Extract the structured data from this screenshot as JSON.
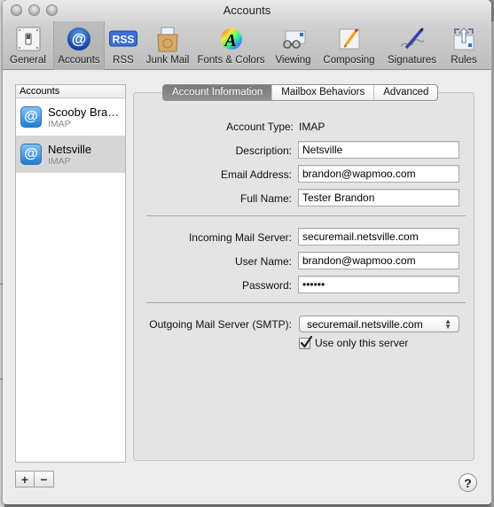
{
  "window": {
    "title": "Accounts"
  },
  "toolbar": {
    "items": [
      {
        "label": "General",
        "icon": "light-switch-icon",
        "selected": false
      },
      {
        "label": "Accounts",
        "icon": "at-sign-icon",
        "selected": true
      },
      {
        "label": "RSS",
        "icon": "rss-icon",
        "selected": false
      },
      {
        "label": "Junk Mail",
        "icon": "recycle-bag-icon",
        "selected": false
      },
      {
        "label": "Fonts & Colors",
        "icon": "color-wheel-font-icon",
        "selected": false
      },
      {
        "label": "Viewing",
        "icon": "glasses-envelope-icon",
        "selected": false
      },
      {
        "label": "Composing",
        "icon": "pencil-paper-icon",
        "selected": false
      },
      {
        "label": "Signatures",
        "icon": "pen-signature-icon",
        "selected": false
      },
      {
        "label": "Rules",
        "icon": "arrows-envelope-icon",
        "selected": false
      }
    ]
  },
  "accounts_list": {
    "header": "Accounts",
    "items": [
      {
        "name": "Scooby Bra…",
        "type": "IMAP",
        "selected": false
      },
      {
        "name": "Netsville",
        "type": "IMAP",
        "selected": true
      }
    ],
    "add_label": "+",
    "remove_label": "−"
  },
  "tabs": [
    {
      "label": "Account Information",
      "active": true
    },
    {
      "label": "Mailbox Behaviors",
      "active": false
    },
    {
      "label": "Advanced",
      "active": false
    }
  ],
  "form": {
    "account_type_label": "Account Type:",
    "account_type_value": "IMAP",
    "description_label": "Description:",
    "description_value": "Netsville",
    "email_label": "Email Address:",
    "email_value": "brandon@wapmoo.com",
    "fullname_label": "Full Name:",
    "fullname_value": "Tester Brandon",
    "incoming_label": "Incoming Mail Server:",
    "incoming_value": "securemail.netsville.com",
    "username_label": "User Name:",
    "username_value": "brandon@wapmoo.com",
    "password_label": "Password:",
    "password_value": "••••••",
    "smtp_label": "Outgoing Mail Server (SMTP):",
    "smtp_value": "securemail.netsville.com",
    "use_only_label": "Use only this server",
    "use_only_checked": true
  },
  "help_label": "?"
}
